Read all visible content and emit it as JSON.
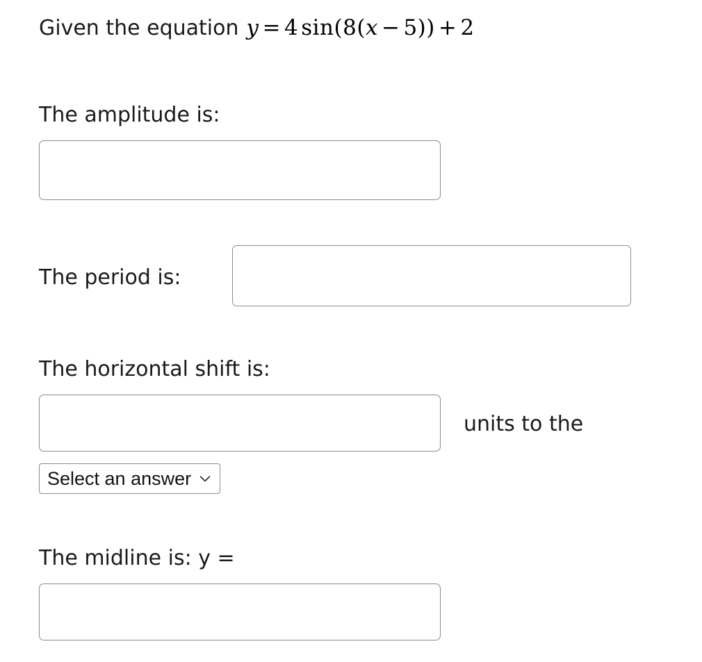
{
  "question": {
    "prompt_prefix": "Given the equation",
    "equation": {
      "lhs": "y",
      "equals": "=",
      "amplitude": "4",
      "function": "sin",
      "open_paren_1": "(",
      "frequency": "8",
      "open_paren_2": "(",
      "variable": "x",
      "minus": "−",
      "shift": "5",
      "close_paren_2": ")",
      "close_paren_1": ")",
      "plus": "+",
      "vertical_shift": "2",
      "plain_text": "y = 4 sin(8(x − 5)) + 2"
    }
  },
  "fields": {
    "amplitude": {
      "label": "The amplitude is:",
      "value": "",
      "placeholder": ""
    },
    "period": {
      "label": "The period is:",
      "value": "",
      "placeholder": ""
    },
    "horizontal_shift": {
      "label": "The horizontal shift is:",
      "value": "",
      "placeholder": "",
      "units_text": "units to the",
      "direction_select": {
        "selected": "Select an answer",
        "icon": "chevron-down-icon"
      }
    },
    "midline": {
      "label": "The midline is: y =",
      "value": "",
      "placeholder": ""
    }
  },
  "colors": {
    "background": "#ffffff",
    "text": "#1a1a1a",
    "input_border": "#8a8a8a",
    "math_text": "#000000"
  }
}
